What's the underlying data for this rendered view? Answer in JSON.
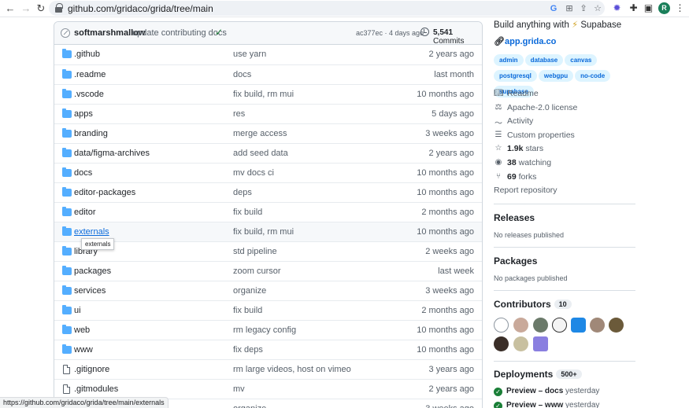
{
  "browser": {
    "url": "github.com/gridaco/grida/tree/main",
    "status_url": "https://github.com/gridaco/grida/tree/main/externals",
    "profile_initial": "R"
  },
  "commit": {
    "author": "softmarshmallow",
    "message": "update contributing docs",
    "meta": "ac377ec · 4 days ago",
    "count": "5,541",
    "count_label": "Commits"
  },
  "files": [
    {
      "name": ".github",
      "type": "dir",
      "message": "use yarn",
      "age": "2 years ago"
    },
    {
      "name": ".readme",
      "type": "dir",
      "message": "docs",
      "age": "last month"
    },
    {
      "name": ".vscode",
      "type": "dir",
      "message": "fix build, rm mui",
      "age": "10 months ago"
    },
    {
      "name": "apps",
      "type": "dir",
      "message": "res",
      "age": "5 days ago"
    },
    {
      "name": "branding",
      "type": "dir",
      "message": "merge access",
      "age": "3 weeks ago"
    },
    {
      "name": "data/figma-archives",
      "type": "dir",
      "message": "add seed data",
      "age": "2 years ago"
    },
    {
      "name": "docs",
      "type": "dir",
      "message": "mv docs ci",
      "age": "10 months ago"
    },
    {
      "name": "editor-packages",
      "type": "dir",
      "message": "deps",
      "age": "10 months ago"
    },
    {
      "name": "editor",
      "type": "dir",
      "message": "fix build",
      "age": "2 months ago"
    },
    {
      "name": "externals",
      "type": "dir",
      "message": "fix build, rm mui",
      "age": "10 months ago"
    },
    {
      "name": "library",
      "type": "dir",
      "message": "std pipeline",
      "age": "2 weeks ago"
    },
    {
      "name": "packages",
      "type": "dir",
      "message": "zoom cursor",
      "age": "last week"
    },
    {
      "name": "services",
      "type": "dir",
      "message": "organize",
      "age": "3 weeks ago"
    },
    {
      "name": "ui",
      "type": "dir",
      "message": "fix build",
      "age": "2 months ago"
    },
    {
      "name": "web",
      "type": "dir",
      "message": "rm legacy config",
      "age": "10 months ago"
    },
    {
      "name": "www",
      "type": "dir",
      "message": "fix deps",
      "age": "10 months ago"
    },
    {
      "name": ".gitignore",
      "type": "file",
      "message": "rm large videos, host on vimeo",
      "age": "3 years ago"
    },
    {
      "name": ".gitmodules",
      "type": "file",
      "message": "mv",
      "age": "2 years ago"
    },
    {
      "name": "",
      "type": "file",
      "message": "organize",
      "age": "3 weeks ago"
    }
  ],
  "tooltip": "externals",
  "sidebar": {
    "about_pre": "Build anything with ",
    "about_post": " Supabase",
    "homepage": "app.grida.co",
    "topics": [
      "admin",
      "database",
      "canvas",
      "postgresql",
      "webgpu",
      "no-code",
      "supabase"
    ],
    "meta": {
      "readme": "Readme",
      "license": "Apache-2.0 license",
      "activity": "Activity",
      "custom_properties": "Custom properties",
      "stars_count": "1.9k",
      "stars_label": " stars",
      "watching_count": "38",
      "watching_label": " watching",
      "forks_count": "69",
      "forks_label": " forks",
      "report": "Report repository"
    },
    "releases_title": "Releases",
    "releases_note": "No releases published",
    "packages_title": "Packages",
    "packages_note": "No packages published",
    "contributors_title": "Contributors",
    "contributors_count": "10",
    "deployments_title": "Deployments",
    "deployments_count": "500+",
    "deployments": [
      {
        "name": "Preview – docs",
        "when": " yesterday"
      },
      {
        "name": "Preview – www",
        "when": " yesterday"
      }
    ]
  }
}
